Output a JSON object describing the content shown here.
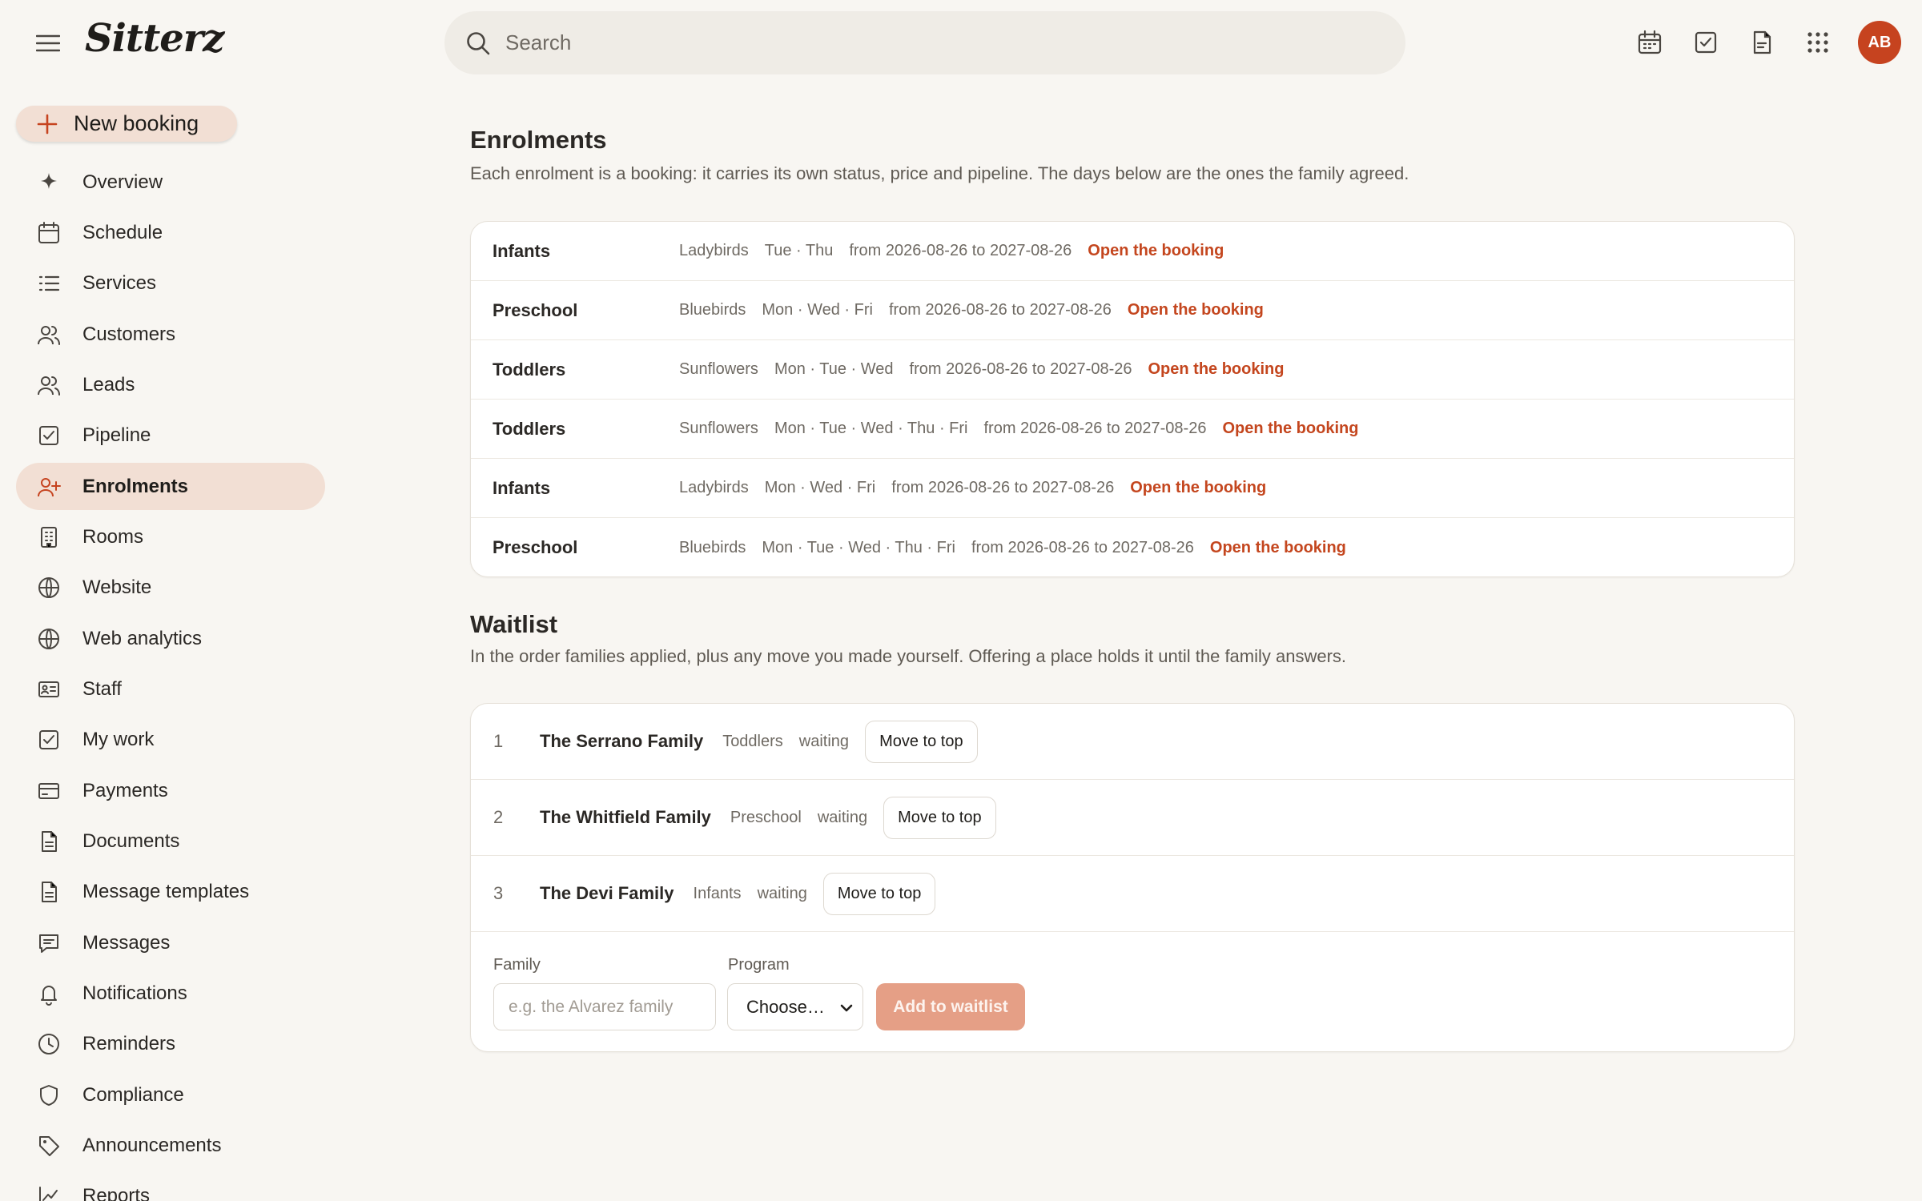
{
  "app": {
    "logo": "Sitterz",
    "user_initials": "AB",
    "accent_color": "#c6431f"
  },
  "search": {
    "placeholder": "Search"
  },
  "sidebar": {
    "new_booking_label": "New booking",
    "items": [
      {
        "label": "Overview",
        "icon": "sparkle-icon"
      },
      {
        "label": "Schedule",
        "icon": "calendar-icon"
      },
      {
        "label": "Services",
        "icon": "list-icon"
      },
      {
        "label": "Customers",
        "icon": "users-icon"
      },
      {
        "label": "Leads",
        "icon": "users-icon"
      },
      {
        "label": "Pipeline",
        "icon": "checkbox-icon"
      },
      {
        "label": "Enrolments",
        "icon": "user-plus-icon",
        "active": true
      },
      {
        "label": "Rooms",
        "icon": "building-icon"
      },
      {
        "label": "Website",
        "icon": "globe-icon"
      },
      {
        "label": "Web analytics",
        "icon": "globe-icon"
      },
      {
        "label": "Staff",
        "icon": "id-card-icon"
      },
      {
        "label": "My work",
        "icon": "checkbox-icon"
      },
      {
        "label": "Payments",
        "icon": "credit-card-icon"
      },
      {
        "label": "Documents",
        "icon": "document-icon"
      },
      {
        "label": "Message templates",
        "icon": "document-icon"
      },
      {
        "label": "Messages",
        "icon": "message-icon"
      },
      {
        "label": "Notifications",
        "icon": "bell-icon"
      },
      {
        "label": "Reminders",
        "icon": "clock-icon"
      },
      {
        "label": "Compliance",
        "icon": "shield-icon"
      },
      {
        "label": "Announcements",
        "icon": "tag-icon"
      },
      {
        "label": "Reports",
        "icon": "chart-icon"
      }
    ]
  },
  "enrolments": {
    "title": "Enrolments",
    "subtitle": "Each enrolment is a booking: it carries its own status, price and pipeline. The days below are the ones the family agreed.",
    "link_label": "Open the booking",
    "rows": [
      {
        "program": "Infants",
        "room": "Ladybirds",
        "days": "Tue · Thu",
        "dates": "from 2026-08-26 to 2027-08-26"
      },
      {
        "program": "Preschool",
        "room": "Bluebirds",
        "days": "Mon · Wed · Fri",
        "dates": "from 2026-08-26 to 2027-08-26"
      },
      {
        "program": "Toddlers",
        "room": "Sunflowers",
        "days": "Mon · Tue · Wed",
        "dates": "from 2026-08-26 to 2027-08-26"
      },
      {
        "program": "Toddlers",
        "room": "Sunflowers",
        "days": "Mon · Tue · Wed · Thu · Fri",
        "dates": "from 2026-08-26 to 2027-08-26"
      },
      {
        "program": "Infants",
        "room": "Ladybirds",
        "days": "Mon · Wed · Fri",
        "dates": "from 2026-08-26 to 2027-08-26"
      },
      {
        "program": "Preschool",
        "room": "Bluebirds",
        "days": "Mon · Tue · Wed · Thu · Fri",
        "dates": "from 2026-08-26 to 2027-08-26"
      }
    ]
  },
  "waitlist": {
    "title": "Waitlist",
    "subtitle": "In the order families applied, plus any move you made yourself. Offering a place holds it until the family answers.",
    "move_label": "Move to top",
    "rows": [
      {
        "position": "1",
        "family": "The Serrano Family",
        "program": "Toddlers",
        "status": "waiting"
      },
      {
        "position": "2",
        "family": "The Whitfield Family",
        "program": "Preschool",
        "status": "waiting"
      },
      {
        "position": "3",
        "family": "The Devi Family",
        "program": "Infants",
        "status": "waiting"
      }
    ],
    "form": {
      "family_label": "Family",
      "family_placeholder": "e.g. the Alvarez family",
      "program_label": "Program",
      "program_value": "Choose…",
      "submit_label": "Add to waitlist"
    }
  }
}
